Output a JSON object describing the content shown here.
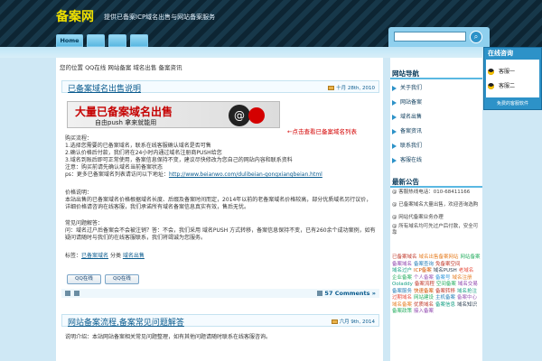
{
  "header": {
    "logo": "备案网",
    "tagline": "提供已备案ICP域名出售与网站备案服务"
  },
  "nav": {
    "home": "Home"
  },
  "search": {
    "placeholder": "",
    "button_glyph": "⌕"
  },
  "breadcrumb": "您的位置 QQ在线 网站备案 域名出售 备案资讯",
  "posts": [
    {
      "title": "已备案域名出售说明",
      "date": "十月 28th, 2010"
    },
    {
      "title": "网站备案流程,备案常见问题解答",
      "date": "六月 9th, 2014",
      "first_line": "说明介绍：本站网站备案相关常见问题整理，如有其他问题请随时联系在线客服咨询。"
    }
  ],
  "banner": {
    "main": "大量已备案域名出售",
    "sub": "自由push 拿来就能用",
    "disc": "@",
    "arrow_text": "←点击查看已备案域名列表"
  },
  "body": {
    "h1": "购买流程：",
    "l1": "1.选择您需要的已备案域名，联系在线客服确认域名是否可售",
    "l2": "2.确认价格后付款，我们将在24小时内通过域名注册商PUSH给您",
    "l3": "3.域名到账后即可正常使用，备案信息保持不变，建议尽快修改为您自己的网站内容和联系资料",
    "l4": "注意：购买前请先确认域名当前备案状态",
    "l5": "ps：更多已备案域名列表请访问以下地址：",
    "url": "http://www.beianwo.com/dulibeian-gongxiangbeian.html",
    "h2": "价格说明：",
    "p2": "本站出售的已备案域名价格根据域名长度、后缀及备案时间而定，2014年以前的老备案域名价格较高，部分优质域名另行议价，详细价格请咨询在线客服，我们承诺所有域名备案信息真实有效，售后无忧。",
    "h3": "常见问题解答：",
    "p3": "问：域名过户后备案会不会被注销？答：不会，我们采用 域名PUSH 方式转移，备案信息保持不变，已有260余个成功案例，如有疑问请随时与我们的在线客服联系，我们将竭诚为您服务。",
    "tags_prefix": "标签：",
    "tag1": "已备案域名",
    "tags_mid": " 分类 ",
    "tag2": "域名出售",
    "qq1": "QQ在线",
    "qq2": "QQ在线"
  },
  "footer": {
    "comments": "57 Comments »"
  },
  "sidebar": {
    "cat_title": "网站导航",
    "cats": [
      "关于我们",
      "网站备案",
      "域名出售",
      "备案资讯",
      "联系我们",
      "客服在线"
    ],
    "news_title": "最新公告",
    "news": [
      "@ 客服热线电话：010-68411166",
      "@ 已备案域名大量出售，欢迎咨询选购",
      "@ 网站代备案业务办理",
      "@ 所有域名均可先过户后付款，安全可靠"
    ],
    "tags": [
      {
        "t": "已备案域名",
        "c": "#c0392b"
      },
      {
        "t": "域名出售备案网站",
        "c": "#e67e22"
      },
      {
        "t": "网站备案",
        "c": "#27ae60"
      },
      {
        "t": "备案域名",
        "c": "#8e44ad"
      },
      {
        "t": "备案查询",
        "c": "#2980b9"
      },
      {
        "t": "免备案空间",
        "c": "#c0392b"
      },
      {
        "t": "域名过户",
        "c": "#16a085"
      },
      {
        "t": "ICP备案",
        "c": "#d35400"
      },
      {
        "t": "域名PUSH",
        "c": "#2c3e50"
      },
      {
        "t": "老域名",
        "c": "#e74c3c"
      },
      {
        "t": "企业备案",
        "c": "#27ae60"
      },
      {
        "t": "个人备案",
        "c": "#9b59b6"
      },
      {
        "t": "备案号",
        "c": "#3498db"
      },
      {
        "t": "域名注册",
        "c": "#e67e22"
      },
      {
        "t": "Ooladdy",
        "c": "#16a085"
      },
      {
        "t": "备案流程",
        "c": "#c0392b"
      },
      {
        "t": "空间备案",
        "c": "#27ae60"
      },
      {
        "t": "域名交易",
        "c": "#8e44ad"
      },
      {
        "t": "备案服务",
        "c": "#2980b9"
      },
      {
        "t": "快速备案",
        "c": "#d35400"
      },
      {
        "t": "备案转移",
        "c": "#c0392b"
      },
      {
        "t": "域名抢注",
        "c": "#16a085"
      },
      {
        "t": "过期域名",
        "c": "#e74c3c"
      },
      {
        "t": "网站建设",
        "c": "#27ae60"
      },
      {
        "t": "主机备案",
        "c": "#2980b9"
      },
      {
        "t": "备案中心",
        "c": "#9b59b6"
      },
      {
        "t": "域名备案",
        "c": "#e67e22"
      },
      {
        "t": "优质域名",
        "c": "#c0392b"
      },
      {
        "t": "备案信息",
        "c": "#16a085"
      },
      {
        "t": "域名知识",
        "c": "#2c3e50"
      },
      {
        "t": "备案政策",
        "c": "#27ae60"
      },
      {
        "t": "接入备案",
        "c": "#8e44ad"
      }
    ]
  },
  "qq_widget": {
    "title": "在线咨询",
    "svc1": "客服一",
    "svc2": "客服二",
    "foot": "免费的客服软件"
  }
}
